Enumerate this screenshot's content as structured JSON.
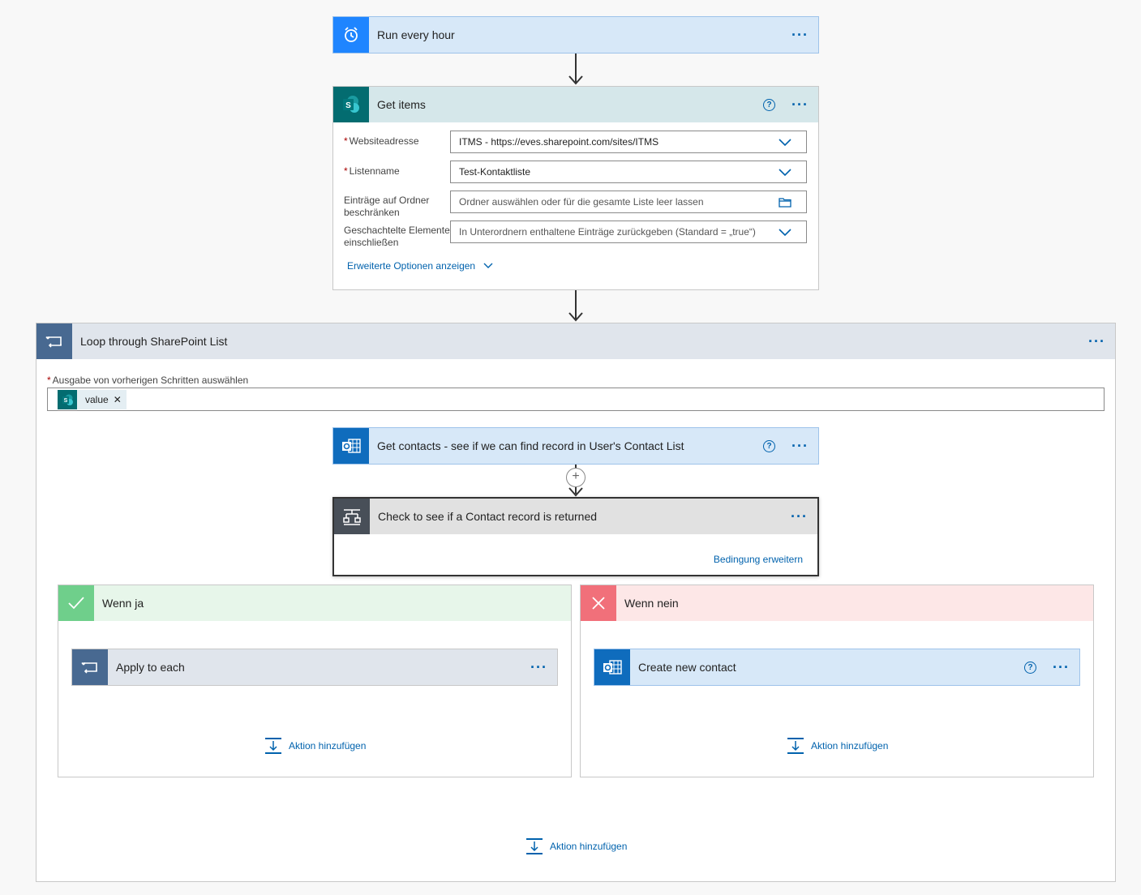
{
  "trigger": {
    "title": "Run every hour",
    "more": "···",
    "icon": "alarm-clock-icon",
    "color": "#1f85ff"
  },
  "get_items": {
    "title": "Get items",
    "more": "···",
    "help": "?",
    "fields": {
      "site": {
        "label": "Websiteadresse",
        "required": "*",
        "value": "ITMS - https://eves.sharepoint.com/sites/ITMS"
      },
      "list": {
        "label": "Listenname",
        "required": "*",
        "value": "Test-Kontaktliste"
      },
      "folder": {
        "label": "Einträge auf Ordner beschränken",
        "placeholder": "Ordner auswählen oder für die gesamte Liste leer lassen"
      },
      "nested": {
        "label": "Geschachtelte Elemente einschließen",
        "placeholder": "In Unterordnern enthaltene Einträge zurückgeben (Standard = „true“)"
      }
    },
    "advanced": "Erweiterte Optionen anzeigen"
  },
  "loop": {
    "title": "Loop through SharePoint List",
    "more": "···",
    "select_label": "Ausgabe von vorherigen Schritten auswählen",
    "required": "*",
    "token": "value",
    "token_remove": "✕",
    "add_action": "Aktion hinzufügen"
  },
  "get_contacts": {
    "title": "Get contacts - see if we can find record in User's Contact List",
    "more": "···",
    "help": "?"
  },
  "insert_step": "+",
  "condition": {
    "title": "Check to see if a Contact record is returned",
    "more": "···",
    "expand": "Bedingung erweitern"
  },
  "yes_branch": {
    "title": "Wenn ja",
    "check": "✓",
    "action": {
      "title": "Apply to each",
      "more": "···"
    },
    "add_action": "Aktion hinzufügen"
  },
  "no_branch": {
    "title": "Wenn nein",
    "cross": "✕",
    "action": {
      "title": "Create new contact",
      "more": "···",
      "help": "?"
    },
    "add_action": "Aktion hinzufügen"
  },
  "colors": {
    "trigger_header": "#d7e8f8",
    "sharepoint_header": "#d5e7ea",
    "loop_header": "#e0e5ec",
    "yes_header": "#e7f6ea",
    "no_header": "#fde7e7",
    "link": "#0062ad"
  }
}
